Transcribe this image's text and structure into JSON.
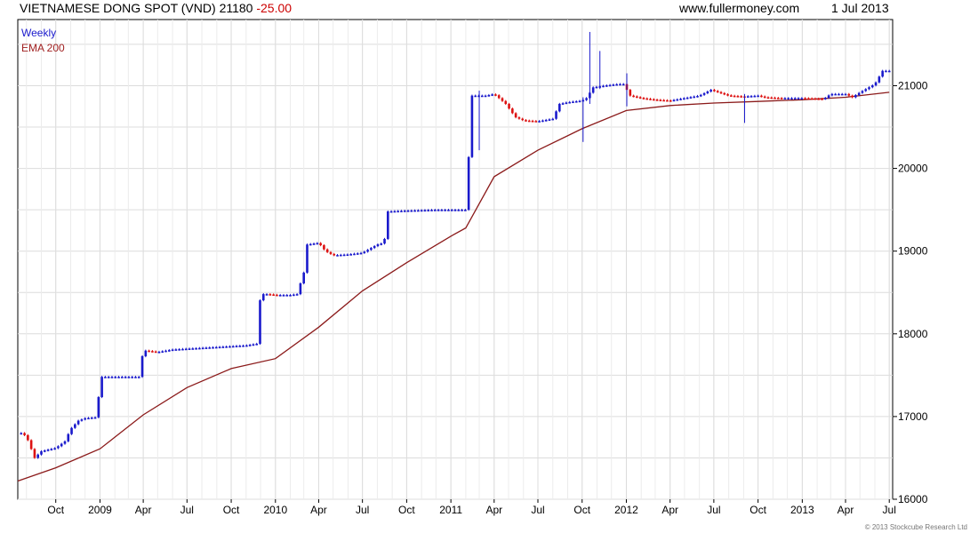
{
  "header": {
    "instrument": "VIETNAMESE DONG SPOT (VND)",
    "last": "21180",
    "change": "-25.00",
    "site": "www.fullermoney.com",
    "date": "1 Jul 2013"
  },
  "footer": {
    "copyright": "© 2013 Stockcube Research Ltd"
  },
  "colors": {
    "up": "#1a1acc",
    "down": "#dd1111",
    "ema": "#8b1a1a",
    "grid": "#dcdcdc"
  },
  "chart_data": {
    "type": "line",
    "legend": [
      "Weekly",
      "EMA 200"
    ],
    "legend_placement": "top-left",
    "grid": true,
    "yaxis_side": "right",
    "ylim": [
      16000,
      21800
    ],
    "yticks": [
      16000,
      17000,
      18000,
      19000,
      20000,
      21000
    ],
    "xlim": [
      "2008-07-14",
      "2013-07-08"
    ],
    "xticks": [
      {
        "date": "2008-10-01",
        "label": "Oct"
      },
      {
        "date": "2009-01-01",
        "label": "2009"
      },
      {
        "date": "2009-04-01",
        "label": "Apr"
      },
      {
        "date": "2009-07-01",
        "label": "Jul"
      },
      {
        "date": "2009-10-01",
        "label": "Oct"
      },
      {
        "date": "2010-01-01",
        "label": "2010"
      },
      {
        "date": "2010-04-01",
        "label": "Apr"
      },
      {
        "date": "2010-07-01",
        "label": "Jul"
      },
      {
        "date": "2010-10-01",
        "label": "Oct"
      },
      {
        "date": "2011-01-01",
        "label": "2011"
      },
      {
        "date": "2011-04-01",
        "label": "Apr"
      },
      {
        "date": "2011-07-01",
        "label": "Jul"
      },
      {
        "date": "2011-10-01",
        "label": "Oct"
      },
      {
        "date": "2012-01-01",
        "label": "2012"
      },
      {
        "date": "2012-04-01",
        "label": "Apr"
      },
      {
        "date": "2012-07-01",
        "label": "Jul"
      },
      {
        "date": "2012-10-01",
        "label": "Oct"
      },
      {
        "date": "2013-01-01",
        "label": "2013"
      },
      {
        "date": "2013-04-01",
        "label": "Apr"
      },
      {
        "date": "2013-07-01",
        "label": "Jul"
      }
    ],
    "series": [
      {
        "name": "Weekly",
        "style": "candlestick",
        "points": [
          [
            "2008-07-21",
            16800
          ],
          [
            "2008-08-01",
            16760
          ],
          [
            "2008-08-18",
            16500
          ],
          [
            "2008-09-01",
            16580
          ],
          [
            "2008-09-15",
            16600
          ],
          [
            "2008-10-01",
            16620
          ],
          [
            "2008-10-20",
            16700
          ],
          [
            "2008-11-01",
            16850
          ],
          [
            "2008-11-17",
            16950
          ],
          [
            "2008-12-01",
            16980
          ],
          [
            "2008-12-22",
            16990
          ],
          [
            "2009-01-05",
            17480
          ],
          [
            "2009-02-01",
            17480
          ],
          [
            "2009-03-01",
            17480
          ],
          [
            "2009-03-23",
            17480
          ],
          [
            "2009-04-01",
            17800
          ],
          [
            "2009-05-01",
            17780
          ],
          [
            "2009-06-01",
            17810
          ],
          [
            "2009-07-01",
            17820
          ],
          [
            "2009-08-01",
            17830
          ],
          [
            "2009-09-01",
            17840
          ],
          [
            "2009-10-01",
            17850
          ],
          [
            "2009-11-01",
            17860
          ],
          [
            "2009-11-23",
            17880
          ],
          [
            "2009-12-01",
            18480
          ],
          [
            "2009-12-15",
            18480
          ],
          [
            "2010-01-01",
            18470
          ],
          [
            "2010-02-01",
            18470
          ],
          [
            "2010-02-15",
            18480
          ],
          [
            "2010-03-01",
            18740
          ],
          [
            "2010-03-08",
            19080
          ],
          [
            "2010-04-01",
            19100
          ],
          [
            "2010-04-15",
            19000
          ],
          [
            "2010-05-01",
            18950
          ],
          [
            "2010-06-01",
            18960
          ],
          [
            "2010-07-01",
            18980
          ],
          [
            "2010-08-01",
            19080
          ],
          [
            "2010-08-15",
            19100
          ],
          [
            "2010-08-23",
            19480
          ],
          [
            "2010-10-01",
            19490
          ],
          [
            "2010-12-01",
            19500
          ],
          [
            "2011-02-01",
            19500
          ],
          [
            "2011-02-14",
            20880
          ],
          [
            "2011-03-15",
            20880
          ],
          [
            "2011-04-01",
            20900
          ],
          [
            "2011-04-25",
            20780
          ],
          [
            "2011-05-15",
            20620
          ],
          [
            "2011-06-01",
            20580
          ],
          [
            "2011-07-01",
            20570
          ],
          [
            "2011-08-01",
            20600
          ],
          [
            "2011-08-15",
            20780
          ],
          [
            "2011-09-01",
            20800
          ],
          [
            "2011-10-01",
            20820
          ],
          [
            "2011-10-10",
            20850
          ],
          [
            "2011-10-24",
            20980
          ],
          [
            "2011-11-15",
            21000
          ],
          [
            "2011-12-15",
            21020
          ],
          [
            "2011-12-26",
            21020
          ],
          [
            "2012-01-09",
            20880
          ],
          [
            "2012-02-01",
            20850
          ],
          [
            "2012-03-01",
            20830
          ],
          [
            "2012-04-01",
            20820
          ],
          [
            "2012-05-01",
            20850
          ],
          [
            "2012-06-01",
            20880
          ],
          [
            "2012-06-25",
            20950
          ],
          [
            "2012-08-01",
            20880
          ],
          [
            "2012-09-01",
            20870
          ],
          [
            "2012-10-01",
            20880
          ],
          [
            "2012-10-15",
            20860
          ],
          [
            "2012-11-15",
            20850
          ],
          [
            "2013-01-01",
            20850
          ],
          [
            "2013-02-15",
            20840
          ],
          [
            "2013-03-01",
            20900
          ],
          [
            "2013-04-01",
            20900
          ],
          [
            "2013-04-15",
            20860
          ],
          [
            "2013-05-01",
            20920
          ],
          [
            "2013-06-01",
            21020
          ],
          [
            "2013-06-17",
            21180
          ],
          [
            "2013-07-01",
            21180
          ]
        ],
        "spikes": [
          [
            "2011-03-01",
            20220,
            20940
          ],
          [
            "2011-10-03",
            20320,
            20860
          ],
          [
            "2011-10-17",
            20780,
            21650
          ],
          [
            "2011-11-07",
            20960,
            21420
          ],
          [
            "2012-01-02",
            20750,
            21150
          ],
          [
            "2012-09-03",
            20550,
            20900
          ]
        ]
      },
      {
        "name": "EMA 200",
        "style": "line",
        "points": [
          [
            "2008-07-14",
            16220
          ],
          [
            "2008-10-01",
            16380
          ],
          [
            "2009-01-01",
            16610
          ],
          [
            "2009-04-01",
            17020
          ],
          [
            "2009-07-01",
            17350
          ],
          [
            "2009-10-01",
            17580
          ],
          [
            "2010-01-01",
            17700
          ],
          [
            "2010-04-01",
            18080
          ],
          [
            "2010-07-01",
            18520
          ],
          [
            "2010-10-01",
            18860
          ],
          [
            "2011-01-01",
            19180
          ],
          [
            "2011-02-01",
            19280
          ],
          [
            "2011-04-01",
            19900
          ],
          [
            "2011-07-01",
            20220
          ],
          [
            "2011-10-01",
            20480
          ],
          [
            "2012-01-01",
            20700
          ],
          [
            "2012-04-01",
            20760
          ],
          [
            "2012-07-01",
            20790
          ],
          [
            "2012-10-01",
            20810
          ],
          [
            "2013-01-01",
            20830
          ],
          [
            "2013-04-01",
            20860
          ],
          [
            "2013-07-01",
            20920
          ]
        ]
      }
    ]
  }
}
